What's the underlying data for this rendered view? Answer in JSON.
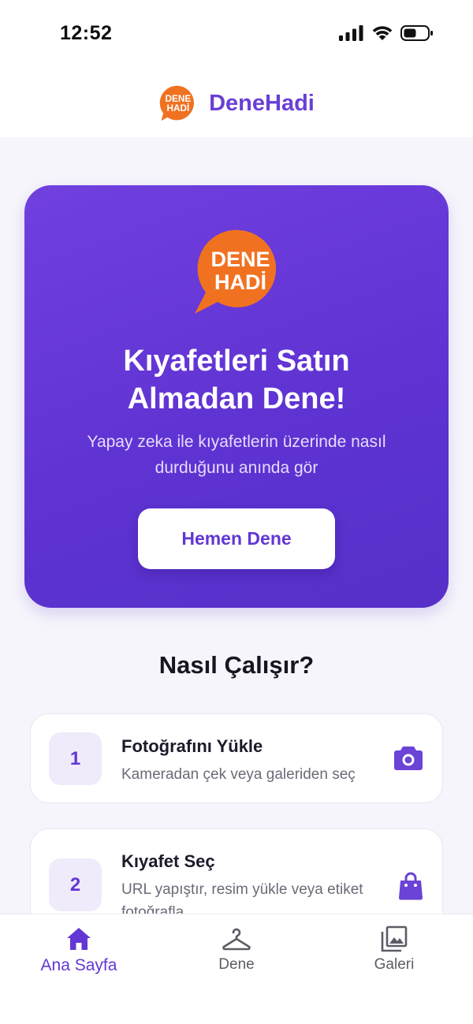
{
  "status": {
    "time": "12:52"
  },
  "header": {
    "title": "DeneHadi"
  },
  "logo": {
    "line1": "DENE",
    "line2": "HADİ",
    "color": "#f07221"
  },
  "hero": {
    "title_line1": "Kıyafetleri Satın",
    "title_line2": "Almadan Dene!",
    "subtitle": "Yapay zeka ile kıyafetlerin üzerinde nasıl durduğunu anında gör",
    "button_label": "Hemen Dene"
  },
  "section": {
    "title": "Nasıl Çalışır?"
  },
  "steps": [
    {
      "number": "1",
      "title": "Fotoğrafını Yükle",
      "description": "Kameradan çek veya galeriden seç",
      "icon": "camera-icon"
    },
    {
      "number": "2",
      "title": "Kıyafet Seç",
      "description": "URL yapıştır, resim yükle veya etiket fotoğrafla",
      "icon": "shopping-bag-icon"
    }
  ],
  "tabs": [
    {
      "label": "Ana Sayfa",
      "icon": "home-icon",
      "active": true
    },
    {
      "label": "Dene",
      "icon": "hanger-icon",
      "active": false
    },
    {
      "label": "Galeri",
      "icon": "gallery-icon",
      "active": false
    }
  ],
  "colors": {
    "accent": "#6237d4",
    "hero_gradient_start": "#7140df",
    "hero_gradient_end": "#5530c8",
    "logo_orange": "#f07221"
  }
}
